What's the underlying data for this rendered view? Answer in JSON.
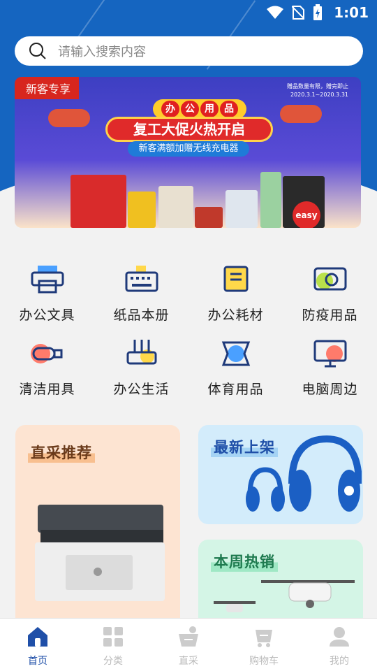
{
  "status_bar": {
    "time": "1:01"
  },
  "search": {
    "placeholder": "请输入搜索内容"
  },
  "banner": {
    "tag": "新客专享",
    "date_line1": "赠品数量有限，赠完即止",
    "date_line2": "2020.3.1~2020.3.31",
    "pill_chars": [
      "办",
      "公",
      "用",
      "品"
    ],
    "headline": "复工大促火热开启",
    "subline": "新客满额加赠无线充电器",
    "brand": "easy"
  },
  "categories": [
    {
      "label": "办公文具",
      "icon": "printer-icon"
    },
    {
      "label": "纸品本册",
      "icon": "keyboard-icon"
    },
    {
      "label": "办公耗材",
      "icon": "clipboard-icon"
    },
    {
      "label": "防疫用品",
      "icon": "camera-icon"
    },
    {
      "label": "清洁用具",
      "icon": "usb-drive-icon"
    },
    {
      "label": "办公生活",
      "icon": "router-icon"
    },
    {
      "label": "体育用品",
      "icon": "gamepad-icon"
    },
    {
      "label": "电脑周边",
      "icon": "monitor-icon"
    }
  ],
  "cards": {
    "direct": {
      "title": "直采推荐"
    },
    "new": {
      "title": "最新上架"
    },
    "hot": {
      "title": "本周热销"
    }
  },
  "tabs": [
    {
      "label": "首页",
      "icon": "home-icon"
    },
    {
      "label": "分类",
      "icon": "grid-icon"
    },
    {
      "label": "直采",
      "icon": "basket-icon"
    },
    {
      "label": "购物车",
      "icon": "cart-icon"
    },
    {
      "label": "我的",
      "icon": "user-icon"
    }
  ],
  "colors": {
    "brand_blue": "#1565c0",
    "icon_navy": "#1f3a7a",
    "active_tab": "#1f4fa8",
    "inactive_tab": "#bbbbbb"
  }
}
